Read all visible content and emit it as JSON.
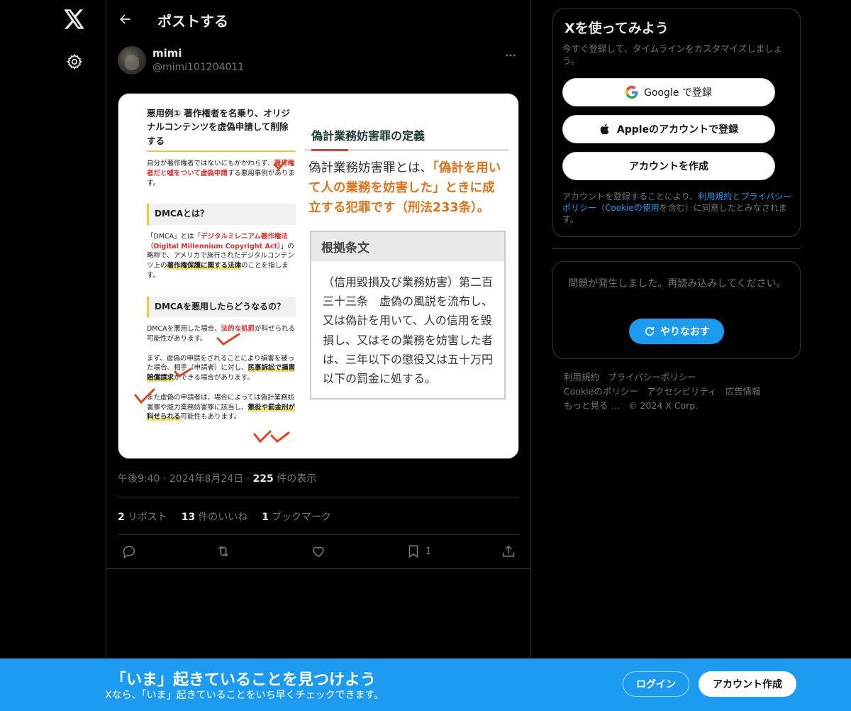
{
  "header": {
    "title": "ポストする"
  },
  "post": {
    "author_name": "mimi",
    "author_handle": "@mimi101204011",
    "time": "午後9:40",
    "date": "2024年8月24日",
    "views_count": "225",
    "views_label": "件の表示",
    "reposts_count": "2",
    "reposts_label": "リポスト",
    "likes_count": "13",
    "likes_label": "件のいいね",
    "bookmarks_count": "1",
    "bookmarks_label": "ブックマーク",
    "bookmark_action_count": "1"
  },
  "media": {
    "left": {
      "title": "悪用例① 著作権者を名乗り、オリジナルコンテンツを虚偽申請して削除する",
      "p1_a": "自分が著作権者ではないにもかかわらず、",
      "p1_red": "著作権者だと嘘をついて虚偽申請",
      "p1_b": "する悪用事例があります。",
      "sec1": "DMCAとは？",
      "p2_a": "「DMCA」とは「",
      "p2_red": "デジタルミレニアム著作権法（Digital Millennium Copyright Act）",
      "p2_b": "」の略称で、アメリカで施行されたデジタルコンテンツ上の",
      "p2_hl": "著作権保護に関する法律",
      "p2_c": "のことを指します。",
      "sec2": "DMCAを悪用したらどうなるの？",
      "p3_a": "DMCAを悪用した場合、",
      "p3_red": "法的な処罰",
      "p3_b": "が科せられる可能性があります。",
      "p4_a": "まず、虚偽の申請をされることにより損害を被った場合、相手（申請者）に対し、",
      "p4_hl": "民事訴訟で損害賠償請求",
      "p4_b": "ができる場合があります。",
      "p5_a": "また虚偽の申請者は、場合によっては偽計業務妨害罪や威力業務妨害罪に該当し、",
      "p5_hl": "懲役や罰金刑が科せられる",
      "p5_b": "可能性もあります。"
    },
    "right": {
      "def_title": "偽計業務妨害罪の定義",
      "def_a": "偽計業務妨害罪とは、",
      "def_or": "「偽計を用いて人の業務を妨害した」ときに成立する犯罪です（刑法233条）。",
      "law_head": "根拠条文",
      "law_body": "（信用毀損及び業務妨害）第二百三十三条　虚偽の風説を流布し、又は偽計を用いて、人の信用を毀損し、又はその業務を妨害した者は、三年以下の懲役又は五十万円以下の罰金に処する。"
    }
  },
  "signup": {
    "title": "Xを使ってみよう",
    "subtitle": "今すぐ登録して、タイムラインをカスタマイズしましょう。",
    "google_label": "Google で登録",
    "apple_label": "Appleのアカウントで登録",
    "create_label": "アカウントを作成",
    "legal_a": "アカウントを登録することにより、",
    "legal_terms": "利用規約",
    "legal_and": "と",
    "legal_privacy": "プライバシーポリシー",
    "legal_b": "（",
    "legal_cookie": "Cookieの使用",
    "legal_c": "を含む）に同意したとみなされます。"
  },
  "error": {
    "message": "問題が発生しました。再読み込みしてください。",
    "retry_label": "やりなおす"
  },
  "footer": {
    "links": [
      "利用規約",
      "プライバシーポリシー",
      "Cookieのポリシー",
      "アクセシビリティ",
      "広告情報",
      "もっと見る …",
      "© 2024 X Corp."
    ]
  },
  "banner": {
    "title": "「いま」起きていることを見つけよう",
    "subtitle": "Xなら、「いま」起きていることをいち早くチェックできます。",
    "login_label": "ログイン",
    "signup_label": "アカウント作成"
  },
  "colors": {
    "accent": "#1d9bf0",
    "background": "#000000",
    "border": "#2f3336",
    "muted": "#71767b"
  },
  "icons": [
    "x-logo-icon",
    "gear-icon",
    "back-arrow-icon",
    "more-icon",
    "reply-icon",
    "repost-icon",
    "like-icon",
    "bookmark-icon",
    "share-icon",
    "google-icon",
    "apple-icon",
    "refresh-icon"
  ]
}
